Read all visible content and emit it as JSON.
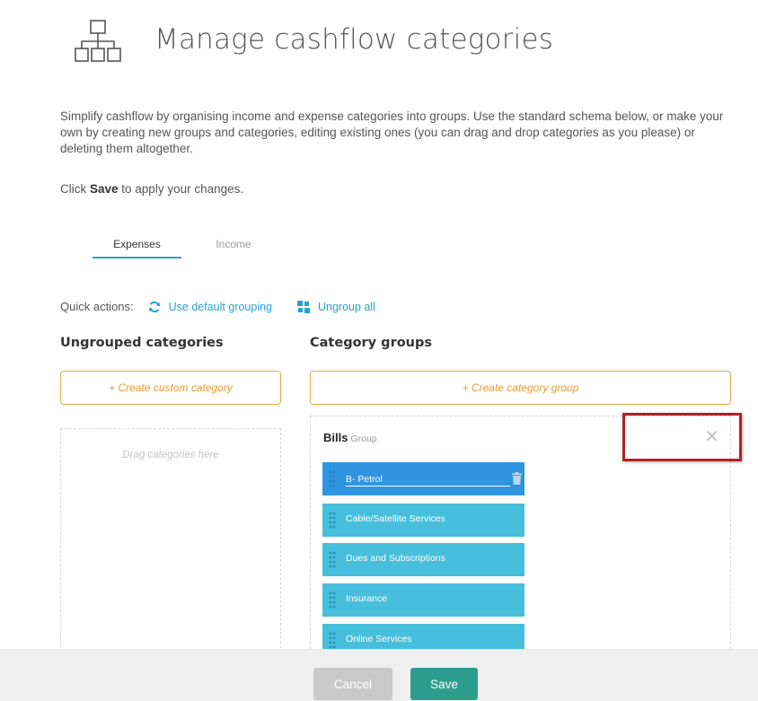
{
  "header": {
    "title": "Manage cashflow categories",
    "icon": "hierarchy-icon"
  },
  "intro": {
    "text": "Simplify cashflow by organising income and expense categories into groups. Use the standard schema below, or make your own by creating new groups and categories, editing existing ones (you can drag and drop categories as you please) or deleting them altogether.",
    "hint_prefix": "Click ",
    "hint_bold": "Save",
    "hint_suffix": " to apply your changes."
  },
  "tabs": [
    {
      "label": "Expenses",
      "active": true
    },
    {
      "label": "Income",
      "active": false
    }
  ],
  "quick_actions": {
    "label": "Quick actions:",
    "default_grouping": "Use default grouping",
    "ungroup_all": "Ungroup all"
  },
  "ungrouped": {
    "title": "Ungrouped categories",
    "create_button": "+ Create custom category",
    "drop_placeholder": "Drag categories here"
  },
  "groups": {
    "title": "Category groups",
    "create_button": "+ Create category group",
    "group": {
      "name": "Bills",
      "type_label": "Group",
      "close_symbol": "×"
    },
    "items": [
      {
        "label": "B- Petrol",
        "editing": true
      },
      {
        "label": "Cable/Satellite Services",
        "editing": false
      },
      {
        "label": "Dues and Subscriptions",
        "editing": false
      },
      {
        "label": "Insurance",
        "editing": false
      },
      {
        "label": "Online Services",
        "editing": false
      }
    ]
  },
  "footer": {
    "cancel": "Cancel",
    "save": "Save"
  },
  "colors": {
    "accent_blue": "#2a9fd6",
    "item_blue": "#47bedb",
    "item_selected": "#2f95e0",
    "orange": "#e89a35",
    "save_green": "#2c9c8f",
    "highlight_red": "#b52024"
  }
}
